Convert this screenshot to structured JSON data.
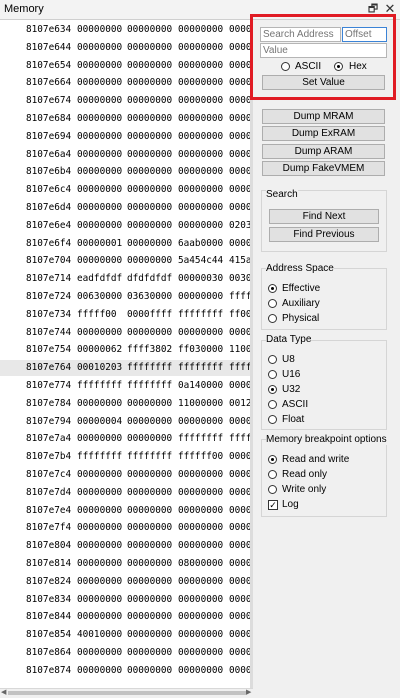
{
  "window": {
    "title": "Memory",
    "restore_icon": "restore-icon",
    "close_icon": "close-icon",
    "close_glyph": "✕",
    "restore_glyph": "🗗"
  },
  "memory_rows": [
    {
      "addr": "8107e634",
      "v": [
        "00000000",
        "00000000",
        "00000000",
        "0000"
      ]
    },
    {
      "addr": "8107e644",
      "v": [
        "00000000",
        "00000000",
        "00000000",
        "0000"
      ]
    },
    {
      "addr": "8107e654",
      "v": [
        "00000000",
        "00000000",
        "00000000",
        "0000"
      ]
    },
    {
      "addr": "8107e664",
      "v": [
        "00000000",
        "00000000",
        "00000000",
        "0000"
      ]
    },
    {
      "addr": "8107e674",
      "v": [
        "00000000",
        "00000000",
        "00000000",
        "0000"
      ]
    },
    {
      "addr": "8107e684",
      "v": [
        "00000000",
        "00000000",
        "00000000",
        "0000"
      ]
    },
    {
      "addr": "8107e694",
      "v": [
        "00000000",
        "00000000",
        "00000000",
        "0000"
      ]
    },
    {
      "addr": "8107e6a4",
      "v": [
        "00000000",
        "00000000",
        "00000000",
        "0000"
      ]
    },
    {
      "addr": "8107e6b4",
      "v": [
        "00000000",
        "00000000",
        "00000000",
        "0000"
      ]
    },
    {
      "addr": "8107e6c4",
      "v": [
        "00000000",
        "00000000",
        "00000000",
        "0000"
      ]
    },
    {
      "addr": "8107e6d4",
      "v": [
        "00000000",
        "00000000",
        "00000000",
        "0000"
      ]
    },
    {
      "addr": "8107e6e4",
      "v": [
        "00000000",
        "00000000",
        "00000000",
        "0203"
      ]
    },
    {
      "addr": "8107e6f4",
      "v": [
        "00000001",
        "00000000",
        "6aab0000",
        "0000"
      ]
    },
    {
      "addr": "8107e704",
      "v": [
        "00000000",
        "00000000",
        "5a454c44",
        "415a"
      ]
    },
    {
      "addr": "8107e714",
      "v": [
        "eadfdfdf",
        "dfdfdfdf",
        "00000030",
        "0030"
      ]
    },
    {
      "addr": "8107e724",
      "v": [
        "00630000",
        "03630000",
        "00000000",
        "ffff"
      ]
    },
    {
      "addr": "8107e734",
      "v": [
        "fffff00",
        "0000ffff",
        "ffffffff",
        "ff00"
      ]
    },
    {
      "addr": "8107e744",
      "v": [
        "00000000",
        "00000000",
        "00000000",
        "0000"
      ]
    },
    {
      "addr": "8107e754",
      "v": [
        "00000062",
        "ffff3802",
        "ff030000",
        "1100"
      ]
    },
    {
      "addr": "8107e764",
      "v": [
        "00010203",
        "ffffffff",
        "ffffffff",
        "ffff"
      ]
    },
    {
      "addr": "8107e774",
      "v": [
        "ffffffff",
        "ffffffff",
        "0a140000",
        "0000"
      ]
    },
    {
      "addr": "8107e784",
      "v": [
        "00000000",
        "00000000",
        "11000000",
        "0012"
      ]
    },
    {
      "addr": "8107e794",
      "v": [
        "00000004",
        "00000000",
        "00000000",
        "0000"
      ]
    },
    {
      "addr": "8107e7a4",
      "v": [
        "00000000",
        "00000000",
        "ffffffff",
        "ffff"
      ]
    },
    {
      "addr": "8107e7b4",
      "v": [
        "ffffffff",
        "ffffffff",
        "ffffff00",
        "0000"
      ]
    },
    {
      "addr": "8107e7c4",
      "v": [
        "00000000",
        "00000000",
        "00000000",
        "0000"
      ]
    },
    {
      "addr": "8107e7d4",
      "v": [
        "00000000",
        "00000000",
        "00000000",
        "0000"
      ]
    },
    {
      "addr": "8107e7e4",
      "v": [
        "00000000",
        "00000000",
        "00000000",
        "0000"
      ]
    },
    {
      "addr": "8107e7f4",
      "v": [
        "00000000",
        "00000000",
        "00000000",
        "0000"
      ]
    },
    {
      "addr": "8107e804",
      "v": [
        "00000000",
        "00000000",
        "00000000",
        "0000"
      ]
    },
    {
      "addr": "8107e814",
      "v": [
        "00000000",
        "00000000",
        "08000000",
        "0000"
      ]
    },
    {
      "addr": "8107e824",
      "v": [
        "00000000",
        "00000000",
        "00000000",
        "0000"
      ]
    },
    {
      "addr": "8107e834",
      "v": [
        "00000000",
        "00000000",
        "00000000",
        "0000"
      ]
    },
    {
      "addr": "8107e844",
      "v": [
        "00000000",
        "00000000",
        "00000000",
        "0000"
      ]
    },
    {
      "addr": "8107e854",
      "v": [
        "40010000",
        "00000000",
        "00000000",
        "0000"
      ]
    },
    {
      "addr": "8107e864",
      "v": [
        "00000000",
        "00000000",
        "00000000",
        "0000"
      ]
    },
    {
      "addr": "8107e874",
      "v": [
        "00000000",
        "00000000",
        "00000000",
        "0000"
      ]
    }
  ],
  "highlighted_row": 19,
  "search": {
    "address_placeholder": "Search Address",
    "offset_placeholder": "Offset",
    "value_placeholder": "Value",
    "ascii_label": "ASCII",
    "hex_label": "Hex",
    "selected": "Hex",
    "set_value_label": "Set Value"
  },
  "dump": {
    "mram_label": "Dump MRAM",
    "exram_label": "Dump ExRAM",
    "aram_label": "Dump ARAM",
    "fakevmem_label": "Dump FakeVMEM"
  },
  "search_group": {
    "title": "Search",
    "find_next_label": "Find Next",
    "find_previous_label": "Find Previous"
  },
  "address_space": {
    "title": "Address Space",
    "options": [
      "Effective",
      "Auxiliary",
      "Physical"
    ],
    "selected": "Effective"
  },
  "data_type": {
    "title": "Data Type",
    "options": [
      "U8",
      "U16",
      "U32",
      "ASCII",
      "Float"
    ],
    "selected": "U32"
  },
  "breakpoint": {
    "title": "Memory breakpoint options",
    "options": [
      "Read and write",
      "Read only",
      "Write only"
    ],
    "selected": "Read and write",
    "log_label": "Log",
    "log_checked": true,
    "check_glyph": "✓"
  },
  "colors": {
    "highlight_box": "#e01b24",
    "focus_border": "#3b83d6"
  }
}
